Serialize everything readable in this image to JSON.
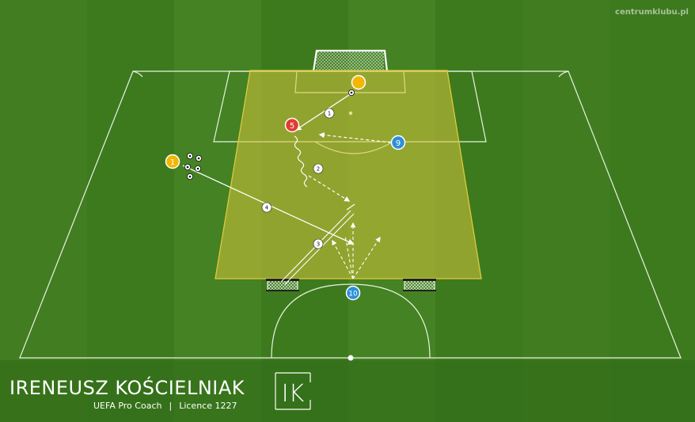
{
  "watermark": "centrumklubu.pl",
  "coach": {
    "name": "IRENEUSZ KOŚCIELNIAK",
    "role": "UEFA Pro Coach",
    "licence": "Licence 1227",
    "logo_text": "IK"
  },
  "colors": {
    "grass": "#3f7a1f",
    "zone_fill": "#d6c43c",
    "zone_border": "#e0c93a",
    "yellow_player": "#f2b705",
    "red_player": "#e23b33",
    "blue_player": "#2f8fd6"
  },
  "players": [
    {
      "id": "gk-yellow",
      "label": "",
      "team": "yellow"
    },
    {
      "id": "yellow-1",
      "label": "1",
      "team": "yellow"
    },
    {
      "id": "red-5",
      "label": "5",
      "team": "red"
    },
    {
      "id": "blue-9",
      "label": "9",
      "team": "blue"
    },
    {
      "id": "blue-10",
      "label": "10",
      "team": "blue"
    }
  ],
  "sequence_markers": [
    "1",
    "2",
    "3",
    "4"
  ],
  "icons": [
    "ball-icon",
    "goal-icon",
    "mini-goal-icon",
    "logo-icon"
  ]
}
